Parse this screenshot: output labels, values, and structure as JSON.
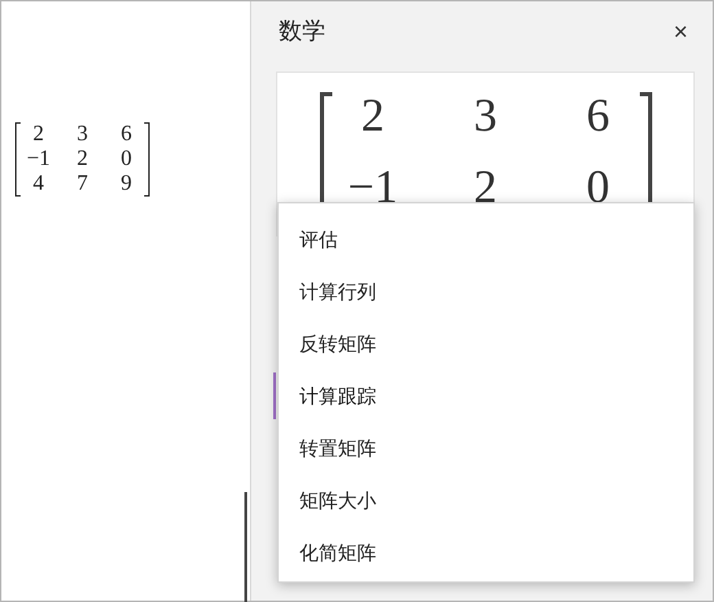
{
  "document": {
    "matrix": [
      [
        "2",
        "3",
        "6"
      ],
      [
        "−1",
        "2",
        "0"
      ],
      [
        "4",
        "7",
        "9"
      ]
    ]
  },
  "panel": {
    "title": "数学",
    "close": "×",
    "preview_matrix": [
      [
        "2",
        "3",
        "6"
      ],
      [
        "−1",
        "2",
        "0"
      ]
    ]
  },
  "menu": {
    "items": [
      {
        "label": "评估",
        "selected": false
      },
      {
        "label": "计算行列",
        "selected": false
      },
      {
        "label": "反转矩阵",
        "selected": false
      },
      {
        "label": "计算跟踪",
        "selected": true
      },
      {
        "label": "转置矩阵",
        "selected": false
      },
      {
        "label": "矩阵大小",
        "selected": false
      },
      {
        "label": "化简矩阵",
        "selected": false
      }
    ]
  }
}
